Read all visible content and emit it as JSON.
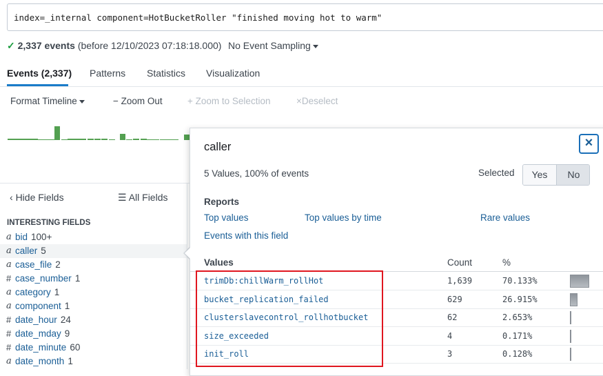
{
  "search": {
    "query": "index=_internal component=HotBucketRoller \"finished moving hot to warm\""
  },
  "summary": {
    "check": "✓",
    "events_count": "2,337 events",
    "before_text": "(before 12/10/2023 07:18:18.000)",
    "sampling_label": "No Event Sampling"
  },
  "tabs": [
    {
      "label": "Events (2,337)",
      "active": true
    },
    {
      "label": "Patterns",
      "active": false
    },
    {
      "label": "Statistics",
      "active": false
    },
    {
      "label": "Visualization",
      "active": false
    }
  ],
  "timeline_toolbar": {
    "format_label": "Format Timeline",
    "zoom_out_label": "Zoom Out",
    "zoom_to_selection_label": "Zoom to Selection",
    "deselect_label": "Deselect"
  },
  "timeline": {
    "bar_color": "#53a051",
    "relative_heights": [
      0.08,
      0.08,
      0.08,
      0.08,
      0.08,
      0.06,
      0.06,
      0.06,
      1.0,
      0.06,
      0.08,
      0.08,
      0.08,
      0.08,
      0.1,
      0.1,
      0.06,
      0.45,
      0.06,
      0.08,
      0.1,
      0.06,
      0.06,
      0.06,
      0.06,
      0.06,
      0.4
    ]
  },
  "fields_panel": {
    "hide_fields_label": "Hide Fields",
    "all_fields_label": "All Fields",
    "interesting_title": "INTERESTING FIELDS",
    "fields": [
      {
        "type": "a",
        "name": "bid",
        "count": "100+",
        "selected": false
      },
      {
        "type": "a",
        "name": "caller",
        "count": "5",
        "selected": true
      },
      {
        "type": "a",
        "name": "case_file",
        "count": "2",
        "selected": false
      },
      {
        "type": "#",
        "name": "case_number",
        "count": "1",
        "selected": false
      },
      {
        "type": "a",
        "name": "category",
        "count": "1",
        "selected": false
      },
      {
        "type": "a",
        "name": "component",
        "count": "1",
        "selected": false
      },
      {
        "type": "#",
        "name": "date_hour",
        "count": "24",
        "selected": false
      },
      {
        "type": "#",
        "name": "date_mday",
        "count": "9",
        "selected": false
      },
      {
        "type": "#",
        "name": "date_minute",
        "count": "60",
        "selected": false
      },
      {
        "type": "a",
        "name": "date_month",
        "count": "1",
        "selected": false
      }
    ]
  },
  "popup": {
    "title": "caller",
    "close_label": "×",
    "values_summary": "5 Values, 100% of events",
    "selected_label": "Selected",
    "yes_label": "Yes",
    "no_label": "No",
    "reports_title": "Reports",
    "reports": {
      "top_values": "Top values",
      "top_values_by_time": "Top values by time",
      "rare_values": "Rare values",
      "events_with_field": "Events with this field"
    },
    "columns": {
      "values": "Values",
      "count": "Count",
      "percent": "%"
    },
    "values": [
      {
        "name": "trimDb:chillWarm_rollHot",
        "count": "1,639",
        "percent": "70.133%",
        "fraction": 0.70133
      },
      {
        "name": "bucket_replication_failed",
        "count": "629",
        "percent": "26.915%",
        "fraction": 0.26915
      },
      {
        "name": "clusterslavecontrol_rollhotbucket",
        "count": "62",
        "percent": "2.653%",
        "fraction": 0.02653
      },
      {
        "name": "size_exceeded",
        "count": "4",
        "percent": "0.171%",
        "fraction": 0.00171
      },
      {
        "name": "init_roll",
        "count": "3",
        "percent": "0.128%",
        "fraction": 0.00128
      }
    ]
  },
  "annotation": {
    "highlight_color": "#e0161f"
  }
}
